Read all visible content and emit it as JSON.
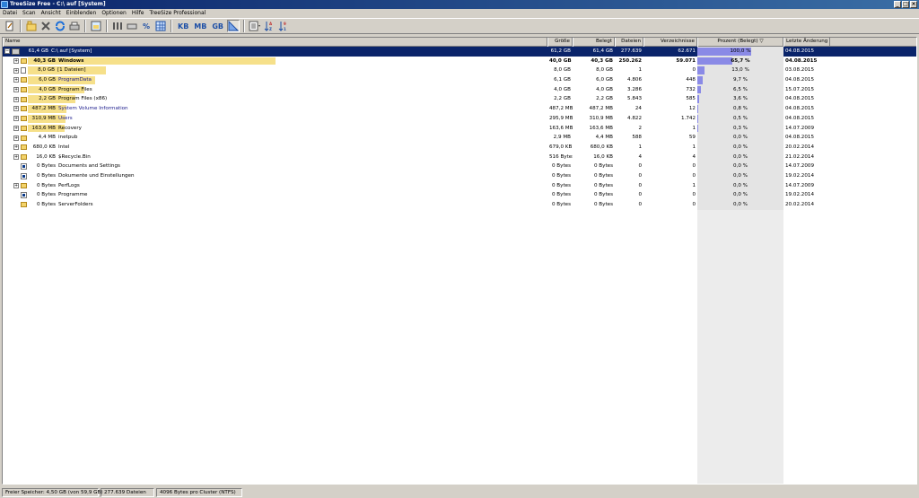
{
  "window": {
    "title": "TreeSize Free - C:\\  auf  [System]",
    "minimize": "_",
    "maximize": "□",
    "close": "×"
  },
  "menu": [
    "Datei",
    "Scan",
    "Ansicht",
    "Einblenden",
    "Optionen",
    "Hilfe",
    "TreeSize Professional"
  ],
  "toolbar": {
    "unit_kb": "KB",
    "unit_mb": "MB",
    "unit_gb": "GB",
    "percent": "%"
  },
  "columns": {
    "name": "Name",
    "size": "Größe",
    "used": "Belegt",
    "files": "Dateien",
    "dirs": "Verzeichnisse",
    "pct": "Prozent (Belegt)",
    "pct_sort": "▽",
    "date": "Letzte Änderung"
  },
  "rows": [
    {
      "size_label": "61,4 GB",
      "name": "C:\\  auf  [System]",
      "size": "61,2 GB",
      "used": "61,4 GB",
      "files": "277.639",
      "dirs": "62.671",
      "pct": "100,0 %",
      "pct_value": 100,
      "date": "04.08.2015",
      "level": 0,
      "icon": "drive-icon",
      "expander": "−",
      "selected": true,
      "bar": 0
    },
    {
      "size_label": "40,3 GB",
      "name": "Windows",
      "size": "40,0 GB",
      "used": "40,3 GB",
      "files": "250.262",
      "dirs": "59.071",
      "pct": "65,7 %",
      "pct_value": 65.7,
      "date": "04.08.2015",
      "level": 1,
      "icon": "folder-icon",
      "expander": "+",
      "bold": true,
      "bar": 65.7
    },
    {
      "size_label": "8,0 GB",
      "name": "[1 Dateien]",
      "size": "8,0 GB",
      "used": "8,0 GB",
      "files": "1",
      "dirs": "0",
      "pct": "13,0 %",
      "pct_value": 13.0,
      "date": "03.08.2015",
      "level": 1,
      "icon": "file-icon",
      "expander": "+",
      "bar": 13.0
    },
    {
      "size_label": "6,0 GB",
      "name": "ProgramData",
      "size": "6,1 GB",
      "used": "6,0 GB",
      "files": "4.806",
      "dirs": "448",
      "pct": "9,7 %",
      "pct_value": 9.7,
      "date": "04.08.2015",
      "level": 1,
      "icon": "folder-icon",
      "expander": "+",
      "blue": true,
      "bar": 9.7
    },
    {
      "size_label": "4,0 GB",
      "name": "Program Files",
      "size": "4,0 GB",
      "used": "4,0 GB",
      "files": "3.286",
      "dirs": "732",
      "pct": "6,5 %",
      "pct_value": 6.5,
      "date": "15.07.2015",
      "level": 1,
      "icon": "folder-icon",
      "expander": "+",
      "bar": 6.5
    },
    {
      "size_label": "2,2 GB",
      "name": "Program Files (x86)",
      "size": "2,2 GB",
      "used": "2,2 GB",
      "files": "5.843",
      "dirs": "585",
      "pct": "3,6 %",
      "pct_value": 3.6,
      "date": "04.08.2015",
      "level": 1,
      "icon": "folder-icon",
      "expander": "+",
      "bar": 3.6
    },
    {
      "size_label": "487,2 MB",
      "name": "System Volume Information",
      "size": "487,2 MB",
      "used": "487,2 MB",
      "files": "24",
      "dirs": "12",
      "pct": "0,8 %",
      "pct_value": 0.8,
      "date": "04.08.2015",
      "level": 1,
      "icon": "folder-icon",
      "expander": "+",
      "blue": true,
      "bar": 0.8
    },
    {
      "size_label": "310,9 MB",
      "name": "Users",
      "size": "295,9 MB",
      "used": "310,9 MB",
      "files": "4.822",
      "dirs": "1.742",
      "pct": "0,5 %",
      "pct_value": 0.5,
      "date": "04.08.2015",
      "level": 1,
      "icon": "folder-icon",
      "expander": "+",
      "blue": true,
      "bar": 0.5
    },
    {
      "size_label": "163,6 MB",
      "name": "Recovery",
      "size": "163,6 MB",
      "used": "163,6 MB",
      "files": "2",
      "dirs": "1",
      "pct": "0,3 %",
      "pct_value": 0.3,
      "date": "14.07.2009",
      "level": 1,
      "icon": "folder-icon",
      "expander": "+",
      "bar": 0.3
    },
    {
      "size_label": "4,4 MB",
      "name": "inetpub",
      "size": "2,9 MB",
      "used": "4,4 MB",
      "files": "588",
      "dirs": "59",
      "pct": "0,0 %",
      "pct_value": 0,
      "date": "04.08.2015",
      "level": 1,
      "icon": "folder-icon",
      "expander": "+",
      "bar": 0
    },
    {
      "size_label": "680,0 KB",
      "name": "Intel",
      "size": "679,0 KB",
      "used": "680,0 KB",
      "files": "1",
      "dirs": "1",
      "pct": "0,0 %",
      "pct_value": 0,
      "date": "20.02.2014",
      "level": 1,
      "icon": "folder-icon",
      "expander": "+",
      "bar": 0
    },
    {
      "size_label": "16,0 KB",
      "name": "$Recycle.Bin",
      "size": "516 Bytes",
      "used": "16,0 KB",
      "files": "4",
      "dirs": "4",
      "pct": "0,0 %",
      "pct_value": 0,
      "date": "21.02.2014",
      "level": 1,
      "icon": "folder-icon",
      "expander": "+",
      "bar": 0
    },
    {
      "size_label": "0 Bytes",
      "name": "Documents and Settings",
      "size": "0 Bytes",
      "used": "0 Bytes",
      "files": "0",
      "dirs": "0",
      "pct": "0,0 %",
      "pct_value": 0,
      "date": "14.07.2009",
      "level": 1,
      "icon": "link-icon",
      "expander": "",
      "bar": 0
    },
    {
      "size_label": "0 Bytes",
      "name": "Dokumente und Einstellungen",
      "size": "0 Bytes",
      "used": "0 Bytes",
      "files": "0",
      "dirs": "0",
      "pct": "0,0 %",
      "pct_value": 0,
      "date": "19.02.2014",
      "level": 1,
      "icon": "link-icon",
      "expander": "",
      "bar": 0
    },
    {
      "size_label": "0 Bytes",
      "name": "PerfLogs",
      "size": "0 Bytes",
      "used": "0 Bytes",
      "files": "0",
      "dirs": "1",
      "pct": "0,0 %",
      "pct_value": 0,
      "date": "14.07.2009",
      "level": 1,
      "icon": "folder-icon",
      "expander": "+",
      "bar": 0
    },
    {
      "size_label": "0 Bytes",
      "name": "Programme",
      "size": "0 Bytes",
      "used": "0 Bytes",
      "files": "0",
      "dirs": "0",
      "pct": "0,0 %",
      "pct_value": 0,
      "date": "19.02.2014",
      "level": 1,
      "icon": "link-icon",
      "expander": "",
      "bar": 0
    },
    {
      "size_label": "0 Bytes",
      "name": "ServerFolders",
      "size": "0 Bytes",
      "used": "0 Bytes",
      "files": "0",
      "dirs": "0",
      "pct": "0,0 %",
      "pct_value": 0,
      "date": "20.02.2014",
      "level": 1,
      "icon": "folder-icon",
      "expander": "",
      "bar": 0
    }
  ],
  "status": {
    "free_space": "Freier Speicher: 4,50 GB  (von 59,9 GB)",
    "file_count": "277.639  Dateien",
    "cluster": "4096 Bytes pro Cluster (NTFS)"
  },
  "colors": {
    "titlebar": "#0a246a",
    "selection": "#0a246a",
    "percent_bar": "#8a8ae6",
    "name_bar": "#f6e08a",
    "folder": "#f3d36a"
  }
}
